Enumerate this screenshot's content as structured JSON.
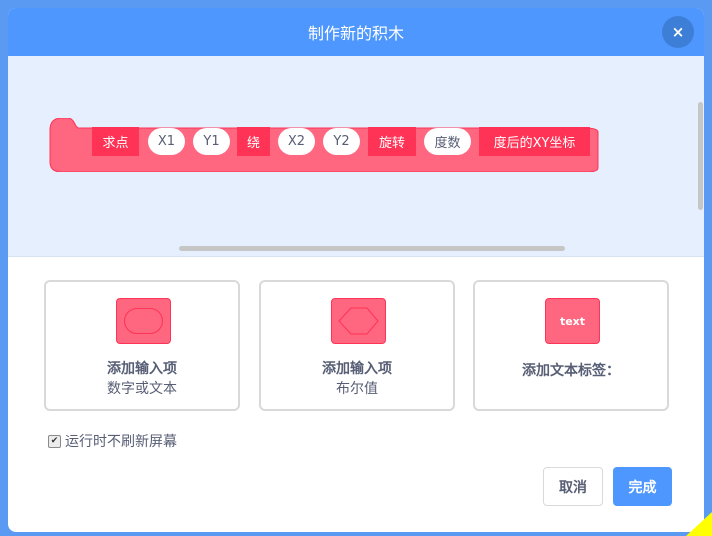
{
  "dialog": {
    "title": "制作新的积木",
    "close_icon": "×"
  },
  "block": {
    "segments": [
      {
        "type": "label",
        "text": "求点"
      },
      {
        "type": "input",
        "text": "X1"
      },
      {
        "type": "input",
        "text": "Y1"
      },
      {
        "type": "label",
        "text": "绕"
      },
      {
        "type": "input",
        "text": "X2"
      },
      {
        "type": "input",
        "text": "Y2"
      },
      {
        "type": "label",
        "text": "旋转"
      },
      {
        "type": "input",
        "text": "度数"
      },
      {
        "type": "label",
        "text": "度后的XY坐标"
      }
    ],
    "color": "#ff6680",
    "accent": "#ff3355"
  },
  "options": [
    {
      "title": "添加输入项",
      "subtitle": "数字或文本",
      "icon": "number-or-text-input-icon"
    },
    {
      "title": "添加输入项",
      "subtitle": "布尔值",
      "icon": "boolean-input-icon"
    },
    {
      "title": "添加文本标签：",
      "subtitle": "",
      "icon": "text-label-icon",
      "icon_text": "text"
    }
  ],
  "run_without_refresh": {
    "label": "运行时不刷新屏幕",
    "checked": true
  },
  "buttons": {
    "cancel": "取消",
    "ok": "完成"
  },
  "colors": {
    "header": "#4d97ff",
    "workspace": "#e5effd",
    "text": "#575e75"
  }
}
